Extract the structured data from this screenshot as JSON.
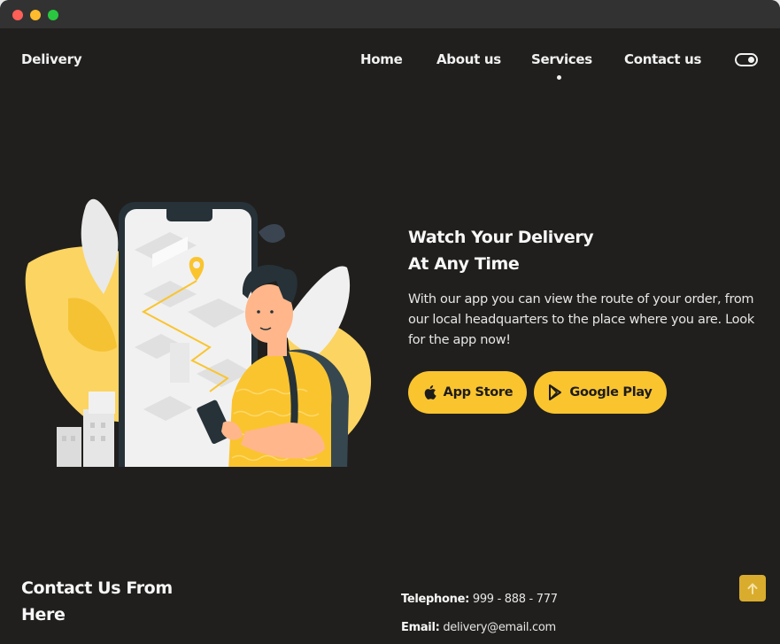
{
  "header": {
    "logo": "Delivery",
    "nav": [
      {
        "label": "Home"
      },
      {
        "label": "About us"
      },
      {
        "label": "Services",
        "active": true
      },
      {
        "label": "Contact us"
      }
    ],
    "theme_toggle_icon": "toggle-icon"
  },
  "hero": {
    "title_line1": "Watch Your Delivery",
    "title_line2": "At Any Time",
    "description": "With our app you can view the route of your order, from our local headquarters to the place where you are. Look for the app now!",
    "buttons": [
      {
        "label": "App Store",
        "icon": "apple-icon"
      },
      {
        "label": "Google Play",
        "icon": "google-play-icon"
      }
    ],
    "illustration": "delivery-person-with-phone-map"
  },
  "contact": {
    "title_line1": "Contact Us From",
    "title_line2": "Here",
    "telephone_label": "Telephone:",
    "telephone_value": "999 - 888 - 777",
    "email_label": "Email:",
    "email_value": "delivery@email.com"
  },
  "scroll_top_icon": "arrow-up-icon",
  "colors": {
    "background": "#201f1d",
    "accent": "#fac42f",
    "text": "#f1f1f1"
  }
}
